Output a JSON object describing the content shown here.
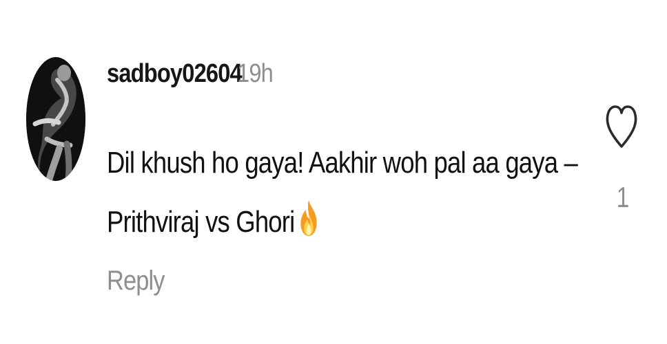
{
  "comment": {
    "username": "sadboy02604",
    "time": "19h",
    "text_lines": [
      "Dil khush ho gaya! Aakhir woh pal aa gaya –",
      "Prithviraj vs Ghori"
    ],
    "emoji_icon": "fire-emoji",
    "reply_label": "Reply",
    "like_icon": "heart-outline-icon",
    "like_count": "1"
  }
}
